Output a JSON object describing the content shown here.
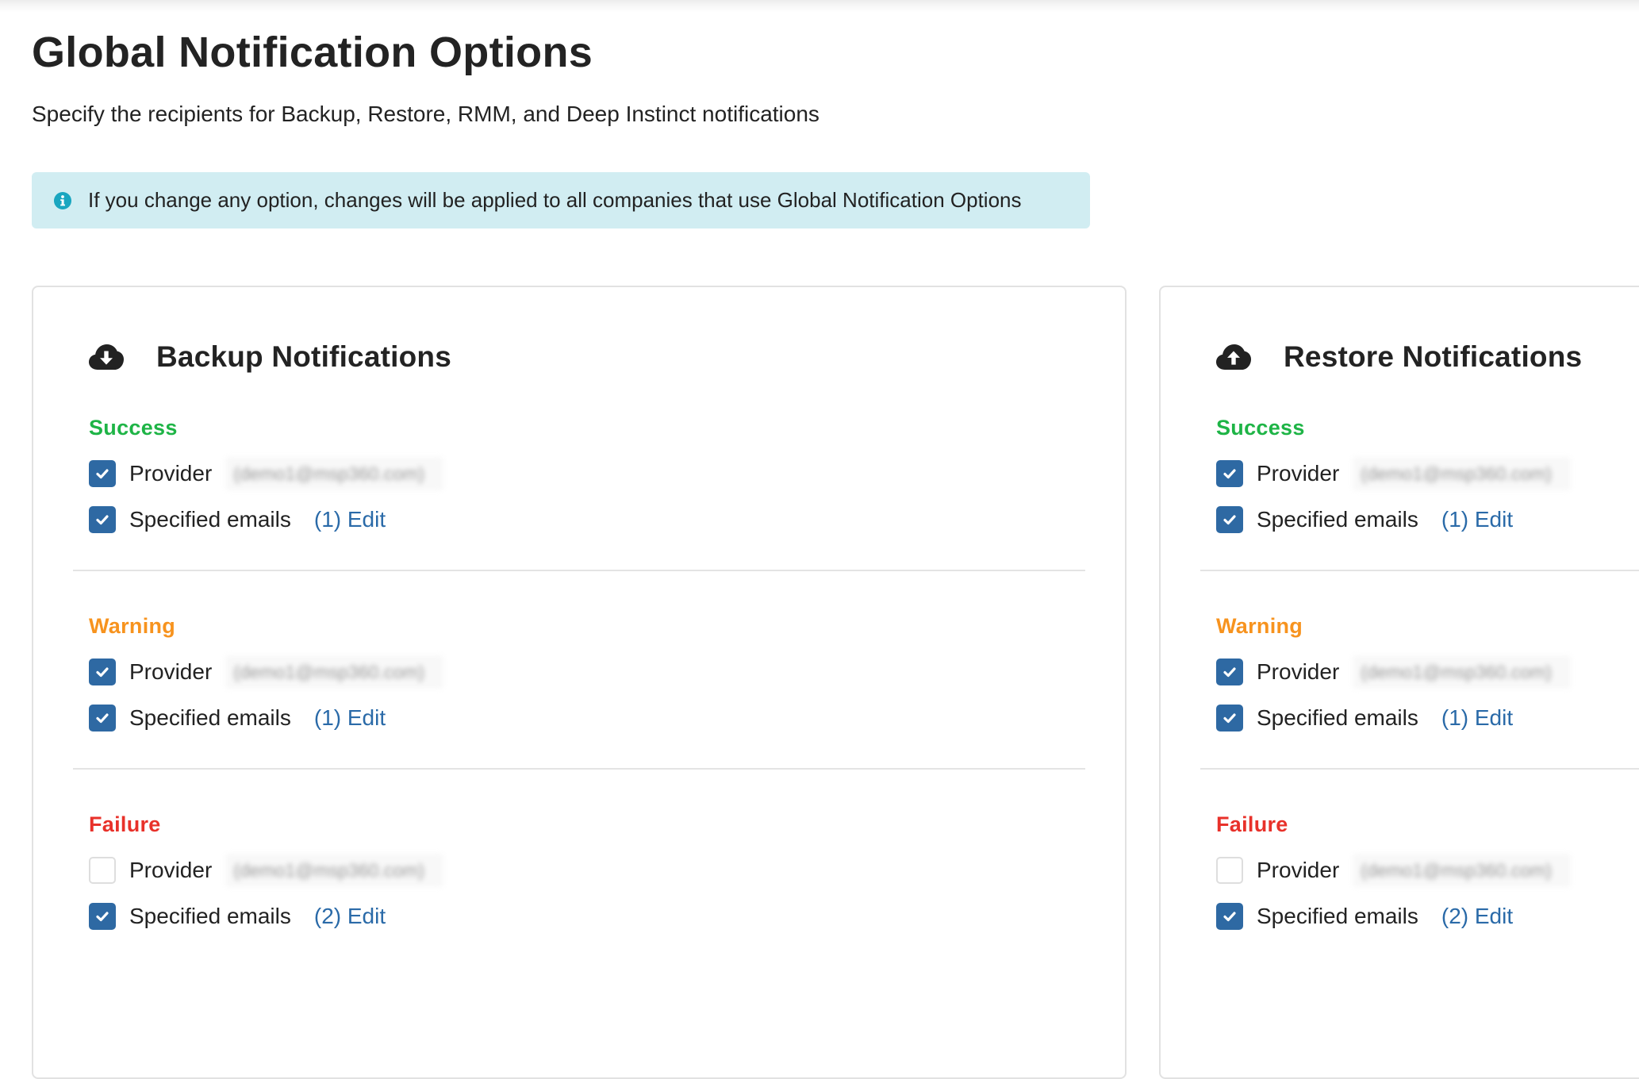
{
  "page": {
    "title": "Global Notification Options",
    "subtitle": "Specify the recipients for Backup, Restore, RMM, and Deep Instinct notifications"
  },
  "banner": {
    "icon": "info-circle-icon",
    "text": "If you change any option, changes will be applied to all companies that use Global Notification Options",
    "background_color": "#d1edf2",
    "icon_color": "#1aa6c0"
  },
  "colors": {
    "success": "#1eb446",
    "warning": "#f7931e",
    "failure": "#e8312a",
    "checkbox": "#2e69a3",
    "link": "#2a6aa8",
    "text": "#222222"
  },
  "cards": [
    {
      "id": "backup",
      "title": "Backup Notifications",
      "icon": "cloud-download-icon",
      "sections": [
        {
          "status": "success",
          "label": "Success",
          "provider": {
            "label": "Provider",
            "checked": true,
            "email": "(demo1@msp360.com)"
          },
          "specified": {
            "label": "Specified emails",
            "checked": true,
            "count": 1,
            "edit_label": "(1) Edit"
          }
        },
        {
          "status": "warning",
          "label": "Warning",
          "provider": {
            "label": "Provider",
            "checked": true,
            "email": "(demo1@msp360.com)"
          },
          "specified": {
            "label": "Specified emails",
            "checked": true,
            "count": 1,
            "edit_label": "(1) Edit"
          }
        },
        {
          "status": "failure",
          "label": "Failure",
          "provider": {
            "label": "Provider",
            "checked": false,
            "email": "(demo1@msp360.com)"
          },
          "specified": {
            "label": "Specified emails",
            "checked": true,
            "count": 2,
            "edit_label": "(2) Edit"
          }
        }
      ]
    },
    {
      "id": "restore",
      "title": "Restore Notifications",
      "icon": "cloud-upload-icon",
      "sections": [
        {
          "status": "success",
          "label": "Success",
          "provider": {
            "label": "Provider",
            "checked": true,
            "email": "(demo1@msp360.com)"
          },
          "specified": {
            "label": "Specified emails",
            "checked": true,
            "count": 1,
            "edit_label": "(1) Edit"
          }
        },
        {
          "status": "warning",
          "label": "Warning",
          "provider": {
            "label": "Provider",
            "checked": true,
            "email": "(demo1@msp360.com)"
          },
          "specified": {
            "label": "Specified emails",
            "checked": true,
            "count": 1,
            "edit_label": "(1) Edit"
          }
        },
        {
          "status": "failure",
          "label": "Failure",
          "provider": {
            "label": "Provider",
            "checked": false,
            "email": "(demo1@msp360.com)"
          },
          "specified": {
            "label": "Specified emails",
            "checked": true,
            "count": 2,
            "edit_label": "(2) Edit"
          }
        }
      ]
    }
  ]
}
